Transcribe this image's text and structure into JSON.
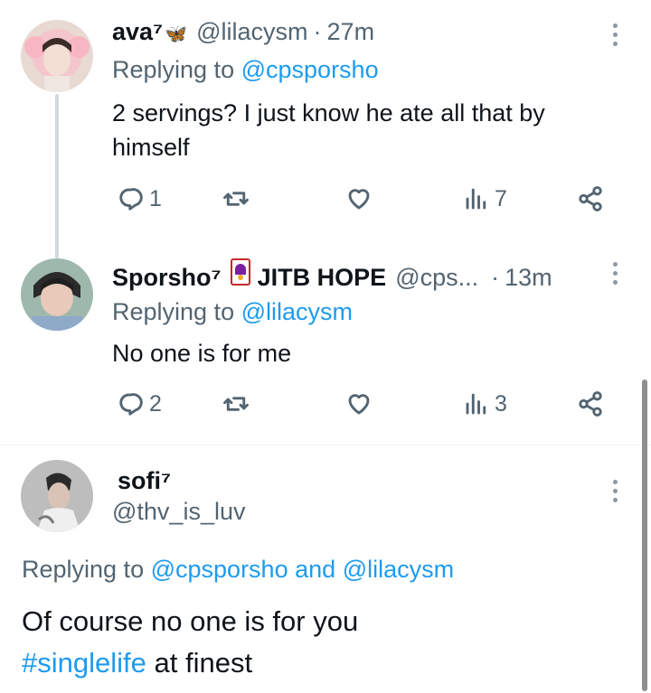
{
  "tweets": [
    {
      "name": "ava⁷",
      "name_emoji": "🦋",
      "handle": "@lilacysm",
      "time": "27m",
      "replying_label": "Replying to",
      "replying_to": "@cpsporsho",
      "text": "2 servings? I just know he ate all that by himself",
      "text_line1": "2 servings? I just know he ate all that by",
      "text_line2": "himself",
      "replies": "1",
      "views": "7"
    },
    {
      "name": "Sporsho⁷",
      "name_suffix": "JITB HOPE",
      "handle": "@cps...",
      "time": "13m",
      "replying_label": "Replying to",
      "replying_to": "@lilacysm",
      "text": "No one is for me",
      "replies": "2",
      "views": "3"
    },
    {
      "name": "sofi⁷",
      "handle": "@thv_is_luv",
      "replying_label": "Replying to",
      "replying_to_a": "@cpsporsho",
      "replying_and": "and",
      "replying_to_b": "@lilacysm",
      "text_line1": "Of course no one is for you",
      "hashtag": "#singlelife",
      "text_line2_rest": "at finest"
    }
  ],
  "icons": {
    "reply": "reply-icon",
    "retweet": "retweet-icon",
    "like": "heart-icon",
    "views": "views-icon",
    "share": "share-icon",
    "more": "more-vertical-icon"
  },
  "colors": {
    "link": "#1d9bf0",
    "secondary_text": "#536471",
    "primary_text": "#0f1419",
    "thread_line": "#cfd9de"
  }
}
